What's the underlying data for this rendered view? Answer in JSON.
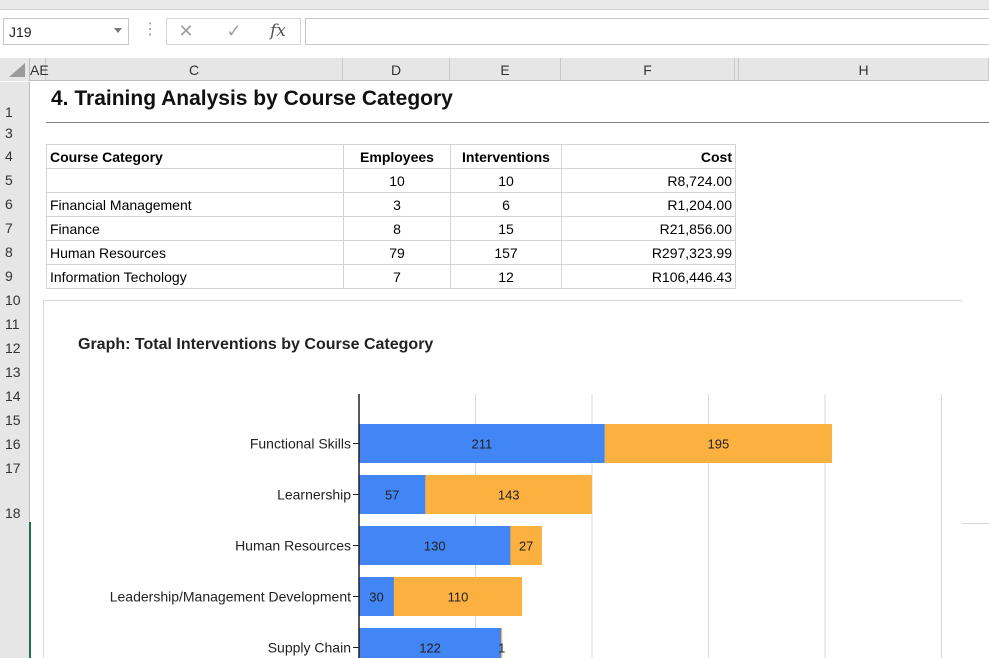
{
  "formula_bar": {
    "name_box": "J19",
    "dots": "⋮",
    "cancel_glyph": "✕",
    "enter_glyph": "✓",
    "fx_label": "fx",
    "formula_value": ""
  },
  "column_headers": [
    "AE",
    "C",
    "D",
    "E",
    "F",
    "H"
  ],
  "row_headers": [
    "1",
    "3",
    "4",
    "5",
    "6",
    "7",
    "8",
    "9",
    "10",
    "11",
    "12",
    "13",
    "14",
    "15",
    "16",
    "17",
    "18"
  ],
  "sheet": {
    "title": "4. Training Analysis by Course Category",
    "table": {
      "headers": [
        "Course Category",
        "Employees",
        "Interventions",
        "Cost"
      ],
      "rows": [
        [
          "",
          "10",
          "10",
          "R8,724.00"
        ],
        [
          "Financial Management",
          "3",
          "6",
          "R1,204.00"
        ],
        [
          "Finance",
          "8",
          "15",
          "R21,856.00"
        ],
        [
          "Human Resources",
          "79",
          "157",
          "R297,323.99"
        ],
        [
          "Information Techology",
          "7",
          "12",
          "R106,446.43"
        ]
      ]
    }
  },
  "colors": {
    "series1": "#4285f4",
    "series2": "#fbb040",
    "gridline": "#d9d9d9",
    "selection_green": "#217346"
  },
  "chart_data": {
    "type": "bar",
    "orientation": "horizontal",
    "stacked": true,
    "title": "Graph: Total Interventions by Course Category",
    "categories": [
      "Functional Skills",
      "Learnership",
      "Human Resources",
      "Leadership/Management Development",
      "Supply Chain"
    ],
    "series": [
      {
        "values": [
          211,
          57,
          130,
          30,
          122
        ],
        "color": "#4285f4"
      },
      {
        "values": [
          195,
          143,
          27,
          110,
          1
        ],
        "color": "#fbb040"
      }
    ],
    "data_labels": [
      [
        "211",
        "57",
        "130",
        "30",
        "122"
      ],
      [
        "195",
        "143",
        "27",
        "110",
        "1"
      ]
    ],
    "xlim": [
      0,
      500
    ],
    "grid": true,
    "legend": "none"
  }
}
